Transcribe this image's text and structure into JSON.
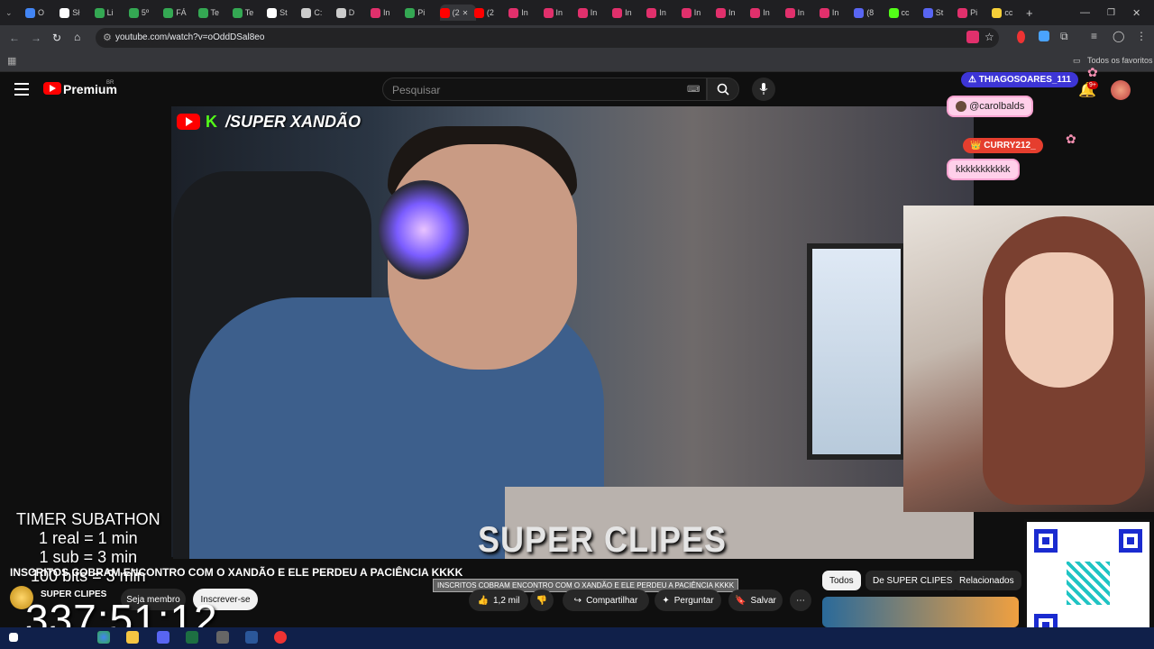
{
  "browser": {
    "tabs": [
      {
        "label": "O",
        "color": "#4285f4"
      },
      {
        "label": "Sł",
        "color": "#ffffff"
      },
      {
        "label": "Li",
        "color": "#34a853"
      },
      {
        "label": "5º",
        "color": "#34a853"
      },
      {
        "label": "FÁ",
        "color": "#34a853"
      },
      {
        "label": "Te",
        "color": "#34a853"
      },
      {
        "label": "Te",
        "color": "#34a853"
      },
      {
        "label": "St",
        "color": "#ffffff"
      },
      {
        "label": "C:",
        "color": "#cccccc"
      },
      {
        "label": "D",
        "color": "#cccccc"
      },
      {
        "label": "In",
        "color": "#e1306c"
      },
      {
        "label": "Pi",
        "color": "#34a853"
      },
      {
        "label": "(2",
        "color": "#ff0000"
      },
      {
        "label": "(2",
        "color": "#ff0000"
      },
      {
        "label": "In",
        "color": "#e1306c"
      },
      {
        "label": "In",
        "color": "#e1306c"
      },
      {
        "label": "In",
        "color": "#e1306c"
      },
      {
        "label": "In",
        "color": "#e1306c"
      },
      {
        "label": "In",
        "color": "#e1306c"
      },
      {
        "label": "In",
        "color": "#e1306c"
      },
      {
        "label": "In",
        "color": "#e1306c"
      },
      {
        "label": "In",
        "color": "#e1306c"
      },
      {
        "label": "In",
        "color": "#e1306c"
      },
      {
        "label": "In",
        "color": "#e1306c"
      },
      {
        "label": "(8",
        "color": "#5865f2"
      },
      {
        "label": "cc",
        "color": "#53fc18"
      },
      {
        "label": "St",
        "color": "#5865f2"
      },
      {
        "label": "Pi",
        "color": "#e1306c"
      },
      {
        "label": "cc",
        "color": "#f7d038"
      }
    ],
    "active_tab_index": 12,
    "url": "youtube.com/watch?v=oOddDSal8eo",
    "bookmarks_folder": "Todos os favoritos"
  },
  "header": {
    "brand": "Premium",
    "brand_region": "BR",
    "search_placeholder": "Pesquisar",
    "notification_count": "9+"
  },
  "video": {
    "watermark_text": "/SUPER XANDÃO",
    "bottom_logo": "SUPER CLIPES"
  },
  "chat_overlay": {
    "messages": [
      {
        "user": "THIAGOSOARES_111",
        "text": "@carolbalds"
      },
      {
        "user": "CURRY212_",
        "text": "kkkkkkkkkkk"
      }
    ]
  },
  "subathon": {
    "title": "TIMER SUBATHON",
    "lines": [
      "1 real = 1 min",
      "1 sub = 3 min",
      "100 bits = 3 min"
    ],
    "countdown": "337:51:12"
  },
  "info": {
    "title": "INSCRITOS COBRAM ENCONTRO COM O XANDÃO E ELE PERDEU A PACIÊNCIA KKKK",
    "tooltip": "INSCRITOS COBRAM ENCONTRO COM O XANDÃO E ELE PERDEU A PACIÊNCIA KKKK",
    "channel": "SUPER CLIPES",
    "member_label": "Seja membro",
    "subscribe_label": "Inscrever-se",
    "likes": "1,2 mil",
    "share_label": "Compartilhar",
    "ask_label": "Perguntar",
    "save_label": "Salvar"
  },
  "related_chips": [
    "Todos",
    "De SUPER CLIPES",
    "Relacionados"
  ]
}
